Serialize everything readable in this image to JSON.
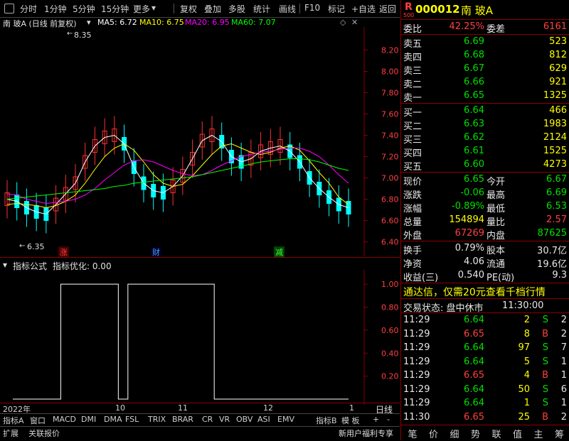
{
  "toolbar": {
    "items": [
      "分时",
      "1分钟",
      "5分钟",
      "15分钟",
      "更多",
      "复权",
      "叠加",
      "多股",
      "统计",
      "画线",
      "F10",
      "标记",
      "+自选",
      "返回"
    ]
  },
  "chart_header": {
    "title": "南 玻A (日线 前复权)",
    "ma5": "MA5: 6.72",
    "ma10": "MA10: 6.75",
    "ma20": "MA20: 6.95",
    "ma60": "MA60: 7.07",
    "high_mark": "8.35",
    "low_mark": "6.35"
  },
  "indicator_header": {
    "name": "指标公式",
    "opt": "指标优化: 0.00"
  },
  "events": {
    "zhang": "涨",
    "cai": "财",
    "jian": "减"
  },
  "colors": {
    "up": "#ff3030",
    "down": "#00ffff",
    "ma5": "#ffffff",
    "ma10": "#ffff00",
    "ma20": "#ff00ff",
    "ma60": "#00ff00",
    "axis": "#8b0000"
  },
  "chart_data": [
    {
      "type": "candlestick",
      "title": "南 玻A (日线 前复权)",
      "ylim": [
        6.35,
        8.35
      ],
      "ytick_labels": [
        "8.20",
        "8.00",
        "7.80",
        "7.60",
        "7.40",
        "7.20",
        "7.00",
        "6.80",
        "6.60",
        "6.40"
      ],
      "xtick_labels": [
        "2022年",
        "10",
        "11",
        "12",
        "1"
      ],
      "series": [
        {
          "name": "MA5",
          "values": [
            6.8,
            6.78,
            6.72,
            6.68,
            6.66,
            6.75,
            6.85,
            6.95,
            7.15,
            7.3,
            7.38,
            7.4,
            7.32,
            7.1,
            6.95,
            6.88,
            6.86,
            6.92,
            7.02,
            7.18,
            7.35,
            7.4,
            7.34,
            7.2,
            7.15,
            7.18,
            7.25,
            7.28,
            7.3,
            7.25,
            7.15,
            7.0,
            6.9,
            6.82,
            6.75,
            6.72
          ]
        },
        {
          "name": "MA10",
          "values": [
            6.75,
            6.76,
            6.75,
            6.74,
            6.72,
            6.74,
            6.78,
            6.84,
            6.95,
            7.08,
            7.2,
            7.28,
            7.32,
            7.26,
            7.15,
            7.03,
            6.95,
            6.92,
            6.94,
            7.02,
            7.12,
            7.22,
            7.3,
            7.32,
            7.28,
            7.24,
            7.22,
            7.24,
            7.28,
            7.3,
            7.26,
            7.16,
            7.05,
            6.95,
            6.82,
            6.75
          ]
        },
        {
          "name": "MA20",
          "values": [
            6.85,
            6.84,
            6.8,
            6.78,
            6.76,
            6.77,
            6.78,
            6.8,
            6.84,
            6.9,
            6.98,
            7.05,
            7.12,
            7.16,
            7.17,
            7.15,
            7.11,
            7.07,
            7.04,
            7.02,
            7.03,
            7.07,
            7.12,
            7.16,
            7.2,
            7.22,
            7.24,
            7.25,
            7.27,
            7.28,
            7.28,
            7.25,
            7.2,
            7.12,
            7.03,
            6.95
          ]
        },
        {
          "name": "MA60",
          "values": [
            6.8,
            6.81,
            6.82,
            6.83,
            6.84,
            6.85,
            6.86,
            6.87,
            6.88,
            6.89,
            6.9,
            6.92,
            6.93,
            6.95,
            6.96,
            6.97,
            6.98,
            6.99,
            7.0,
            7.01,
            7.03,
            7.05,
            7.07,
            7.09,
            7.11,
            7.13,
            7.15,
            7.16,
            7.17,
            7.18,
            7.18,
            7.17,
            7.15,
            7.12,
            7.09,
            7.07
          ]
        }
      ]
    },
    {
      "type": "line",
      "title": "指标公式",
      "ylim": [
        0,
        1.1
      ],
      "ytick_labels": [
        "1.00",
        "0.80",
        "0.60",
        "0.40",
        "0.20"
      ],
      "series": [
        {
          "name": "",
          "values": [
            0,
            0,
            0,
            0,
            0,
            1,
            1,
            1,
            1,
            1,
            1,
            0,
            1,
            1,
            1,
            1,
            1,
            1,
            1,
            1,
            1,
            0,
            0,
            0,
            0,
            0,
            0,
            0,
            0,
            0,
            0,
            0,
            0,
            0,
            0,
            0
          ]
        }
      ]
    }
  ],
  "bottom_tabs": [
    "指标A",
    "窗口",
    "MACD",
    "DMI",
    "DMA",
    "FSL",
    "TRIX",
    "BRAR",
    "CR",
    "VR",
    "OBV",
    "ASI",
    "EMV",
    "指标B",
    "模 板",
    "+",
    "-"
  ],
  "bottom_tabs_right": "日线",
  "bottom_bar": {
    "ext": "扩展",
    "link": "关联报价",
    "promo": "新用户福利专享"
  },
  "quote": {
    "market": "R",
    "market_sub": "500",
    "code": "000012",
    "name": "南 玻A",
    "wb_label": "委比",
    "wb_value": "42.25%",
    "wc_label": "委差",
    "wc_value": "6161",
    "asks": [
      {
        "label": "卖五",
        "price": "6.69",
        "vol": "523"
      },
      {
        "label": "卖四",
        "price": "6.68",
        "vol": "812"
      },
      {
        "label": "卖三",
        "price": "6.67",
        "vol": "629"
      },
      {
        "label": "卖二",
        "price": "6.66",
        "vol": "921"
      },
      {
        "label": "卖一",
        "price": "6.65",
        "vol": "1325"
      }
    ],
    "bids": [
      {
        "label": "买一",
        "price": "6.64",
        "vol": "466"
      },
      {
        "label": "买二",
        "price": "6.63",
        "vol": "1983"
      },
      {
        "label": "买三",
        "price": "6.62",
        "vol": "2124"
      },
      {
        "label": "买四",
        "price": "6.61",
        "vol": "1525"
      },
      {
        "label": "买五",
        "price": "6.60",
        "vol": "4273"
      }
    ],
    "stats": [
      {
        "l1": "现价",
        "v1": "6.65",
        "l2": "今开",
        "v2": "6.67",
        "c1": "grn",
        "c2": "grn"
      },
      {
        "l1": "涨跌",
        "v1": "-0.06",
        "l2": "最高",
        "v2": "6.69",
        "c1": "grn",
        "c2": "grn"
      },
      {
        "l1": "涨幅",
        "v1": "-0.89%",
        "l2": "最低",
        "v2": "6.53",
        "c1": "grn",
        "c2": "grn"
      },
      {
        "l1": "总量",
        "v1": "154894",
        "l2": "量比",
        "v2": "2.57",
        "c1": "yel",
        "c2": "red"
      },
      {
        "l1": "外盘",
        "v1": "67269",
        "l2": "内盘",
        "v2": "87625",
        "c1": "red",
        "c2": "grn"
      }
    ],
    "fin": [
      {
        "l1": "换手",
        "v1": "0.79%",
        "l2": "股本",
        "v2": "30.7亿"
      },
      {
        "l1": "净资",
        "v1": "4.06",
        "l2": "流通",
        "v2": "19.6亿"
      },
      {
        "l1": "收益(三)",
        "v1": "0.540",
        "l2": "PE(动)",
        "v2": "9.3"
      }
    ],
    "promo": "通达信，仅需20元查看千档行情",
    "status_label": "交易状态: 盘中休市",
    "status_time": "11:30:00",
    "ticks": [
      {
        "t": "11:29",
        "p": "6.64",
        "v": "2",
        "s": "S",
        "n": "2"
      },
      {
        "t": "11:29",
        "p": "6.65",
        "v": "8",
        "s": "B",
        "n": "2"
      },
      {
        "t": "11:29",
        "p": "6.64",
        "v": "97",
        "s": "S",
        "n": "7"
      },
      {
        "t": "11:29",
        "p": "6.64",
        "v": "5",
        "s": "S",
        "n": "1"
      },
      {
        "t": "11:29",
        "p": "6.65",
        "v": "4",
        "s": "B",
        "n": "1"
      },
      {
        "t": "11:29",
        "p": "6.64",
        "v": "50",
        "s": "S",
        "n": "6"
      },
      {
        "t": "11:29",
        "p": "6.64",
        "v": "1",
        "s": "S",
        "n": "1"
      },
      {
        "t": "11:30",
        "p": "6.65",
        "v": "25",
        "s": "B",
        "n": "2"
      }
    ],
    "tabs": [
      "笔",
      "价",
      "细",
      "势",
      "联",
      "值",
      "主",
      "筹"
    ]
  }
}
